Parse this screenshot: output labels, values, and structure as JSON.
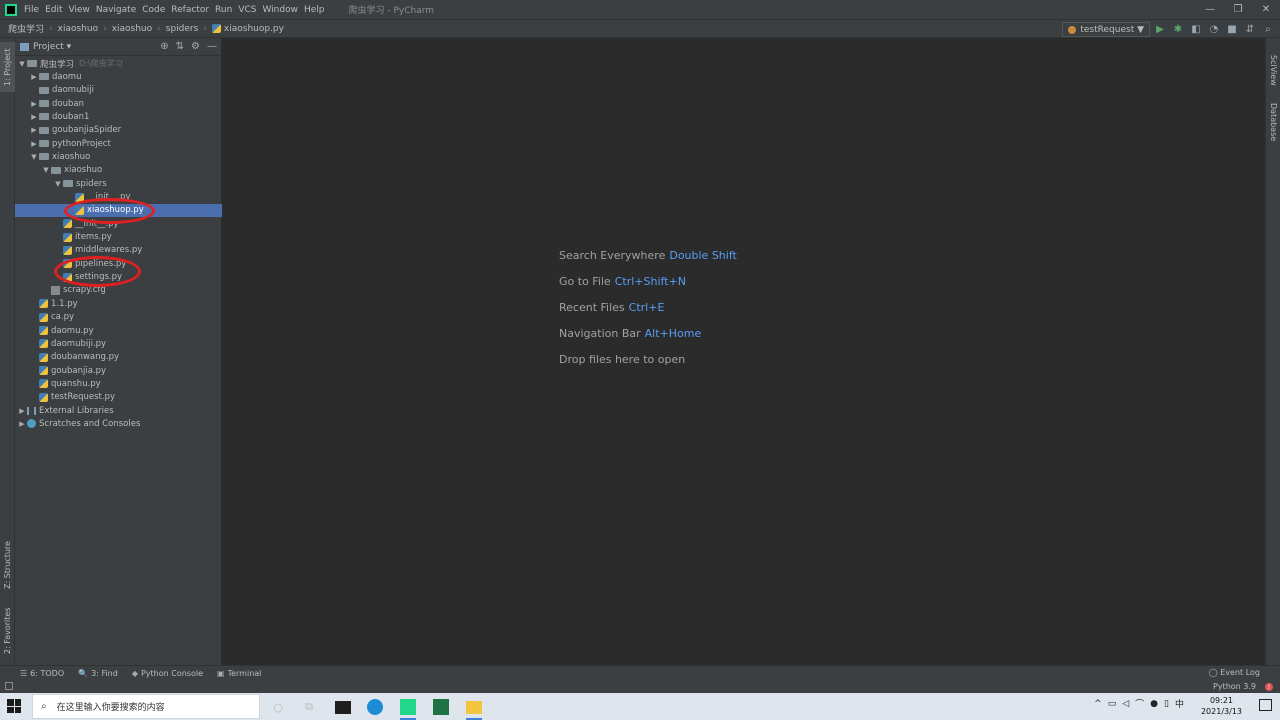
{
  "titlebar": {
    "menu": [
      "File",
      "Edit",
      "View",
      "Navigate",
      "Code",
      "Refactor",
      "Run",
      "VCS",
      "Window",
      "Help"
    ],
    "window_title": "爬虫学习 - PyCharm",
    "minimize": "—",
    "restore": "❐",
    "close": "✕"
  },
  "navbar": {
    "crumbs": [
      "爬虫学习",
      "xiaoshuo",
      "xiaoshuo",
      "spiders"
    ],
    "file": "xiaoshuop.py",
    "run_config": "testRequest ▼"
  },
  "stripes": {
    "project_tab": "1: Project",
    "structure_tab": "Z: Structure",
    "favorites_tab": "2: Favorites",
    "sciview_tab": "SciView",
    "database_tab": "Database"
  },
  "project_panel": {
    "title": "Project ▾",
    "tree": [
      {
        "label": "爬虫学习",
        "hint": "D:\\爬虫学习",
        "type": "folder",
        "arrow": "▼",
        "indent": 0
      },
      {
        "label": "daomu",
        "type": "folder",
        "arrow": "▶",
        "indent": 1
      },
      {
        "label": "daomubiji",
        "type": "folder",
        "arrow": "",
        "indent": 1
      },
      {
        "label": "douban",
        "type": "folder",
        "arrow": "▶",
        "indent": 1
      },
      {
        "label": "douban1",
        "type": "folder",
        "arrow": "▶",
        "indent": 1
      },
      {
        "label": "goubanjiaSpider",
        "type": "folder",
        "arrow": "▶",
        "indent": 1
      },
      {
        "label": "pythonProject",
        "type": "folder",
        "arrow": "▶",
        "indent": 1
      },
      {
        "label": "xiaoshuo",
        "type": "folder",
        "arrow": "▼",
        "indent": 1
      },
      {
        "label": "xiaoshuo",
        "type": "folder",
        "arrow": "▼",
        "indent": 2
      },
      {
        "label": "spiders",
        "type": "folder",
        "arrow": "▼",
        "indent": 3
      },
      {
        "label": "__init__.py",
        "type": "py",
        "arrow": "",
        "indent": 4
      },
      {
        "label": "xiaoshuop.py",
        "type": "py",
        "arrow": "",
        "indent": 4,
        "selected": true
      },
      {
        "label": "__init__.py",
        "type": "py",
        "arrow": "",
        "indent": 3
      },
      {
        "label": "items.py",
        "type": "py",
        "arrow": "",
        "indent": 3
      },
      {
        "label": "middlewares.py",
        "type": "py",
        "arrow": "",
        "indent": 3
      },
      {
        "label": "pipelines.py",
        "type": "py",
        "arrow": "",
        "indent": 3
      },
      {
        "label": "settings.py",
        "type": "py",
        "arrow": "",
        "indent": 3
      },
      {
        "label": "scrapy.cfg",
        "type": "cfg",
        "arrow": "",
        "indent": 2
      },
      {
        "label": "1.1.py",
        "type": "py",
        "arrow": "",
        "indent": 1
      },
      {
        "label": "ca.py",
        "type": "py",
        "arrow": "",
        "indent": 1
      },
      {
        "label": "daomu.py",
        "type": "py",
        "arrow": "",
        "indent": 1
      },
      {
        "label": "daomubiji.py",
        "type": "py",
        "arrow": "",
        "indent": 1
      },
      {
        "label": "doubanwang.py",
        "type": "py",
        "arrow": "",
        "indent": 1
      },
      {
        "label": "goubanjia.py",
        "type": "py",
        "arrow": "",
        "indent": 1
      },
      {
        "label": "quanshu.py",
        "type": "py",
        "arrow": "",
        "indent": 1
      },
      {
        "label": "testRequest.py",
        "type": "py",
        "arrow": "",
        "indent": 1
      },
      {
        "label": "External Libraries",
        "type": "lib",
        "arrow": "▶",
        "indent": 0
      },
      {
        "label": "Scratches and Consoles",
        "type": "scratch",
        "arrow": "▶",
        "indent": 0
      }
    ]
  },
  "editor_hints": [
    {
      "text": "Search Everywhere",
      "key": "Double Shift"
    },
    {
      "text": "Go to File",
      "key": "Ctrl+Shift+N"
    },
    {
      "text": "Recent Files",
      "key": "Ctrl+E"
    },
    {
      "text": "Navigation Bar",
      "key": "Alt+Home"
    },
    {
      "text": "Drop files here to open",
      "key": ""
    }
  ],
  "bottom_tabs": [
    {
      "icon": "☰",
      "label": "6: TODO"
    },
    {
      "icon": "🔍",
      "label": "3: Find"
    },
    {
      "icon": "◆",
      "label": "Python Console"
    },
    {
      "icon": "▣",
      "label": "Terminal"
    }
  ],
  "event_log": "Event Log",
  "status": {
    "python": "Python 3.9",
    "error": "!"
  },
  "taskbar": {
    "search_placeholder": "在这里输入你要搜索的内容",
    "time": "09:21",
    "date": "2021/3/13"
  }
}
